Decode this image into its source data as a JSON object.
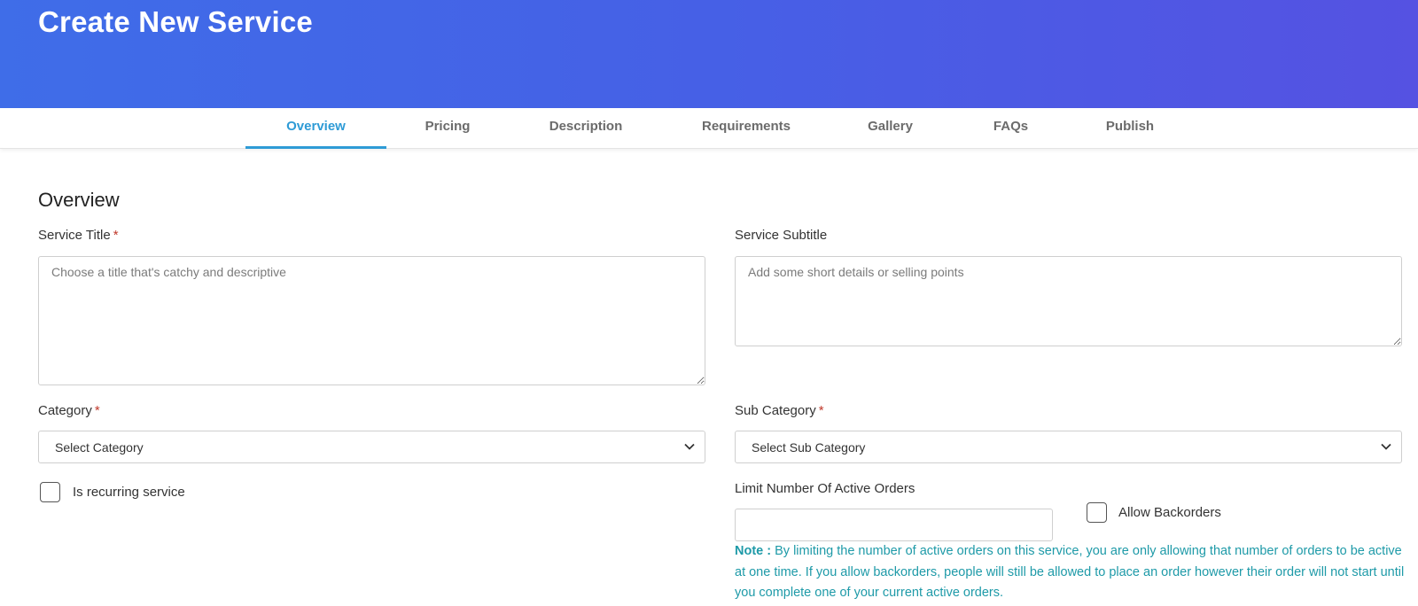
{
  "header": {
    "title": "Create New Service"
  },
  "tabs": [
    {
      "label": "Overview",
      "active": true
    },
    {
      "label": "Pricing",
      "active": false
    },
    {
      "label": "Description",
      "active": false
    },
    {
      "label": "Requirements",
      "active": false
    },
    {
      "label": "Gallery",
      "active": false
    },
    {
      "label": "FAQs",
      "active": false
    },
    {
      "label": "Publish",
      "active": false
    }
  ],
  "overview": {
    "title": "Overview",
    "service_title": {
      "label": "Service Title",
      "required": "*",
      "value": "",
      "placeholder": "Choose a title that's catchy and descriptive"
    },
    "service_subtitle": {
      "label": "Service Subtitle",
      "value": "",
      "placeholder": "Add some short details or selling points"
    },
    "category": {
      "label": "Category",
      "required": "*",
      "selected": "Select Category"
    },
    "sub_category": {
      "label": "Sub Category",
      "required": "*",
      "selected": "Select Sub Category"
    },
    "recurring": {
      "label": "Is recurring service",
      "checked": false
    },
    "limit_orders": {
      "label": "Limit Number Of Active Orders",
      "value": ""
    },
    "allow_backorders": {
      "label": "Allow Backorders",
      "checked": false
    },
    "note": {
      "prefix": "Note :",
      "text": "By limiting the number of active orders on this service, you are only allowing that number of orders to be active at one time. If you allow backorders, people will still be allowed to place an order however their order will not start until you complete one of your current active orders."
    }
  },
  "colors": {
    "header_gradient_start": "#3f6de8",
    "header_gradient_end": "#5552e2",
    "tab_active": "#2e9bd6",
    "note_text": "#1e9aa8",
    "required_marker": "#c0392b"
  },
  "icons": {
    "select_arrow": "chevron-down-icon",
    "textarea_resize": "resize-handle-icon"
  }
}
